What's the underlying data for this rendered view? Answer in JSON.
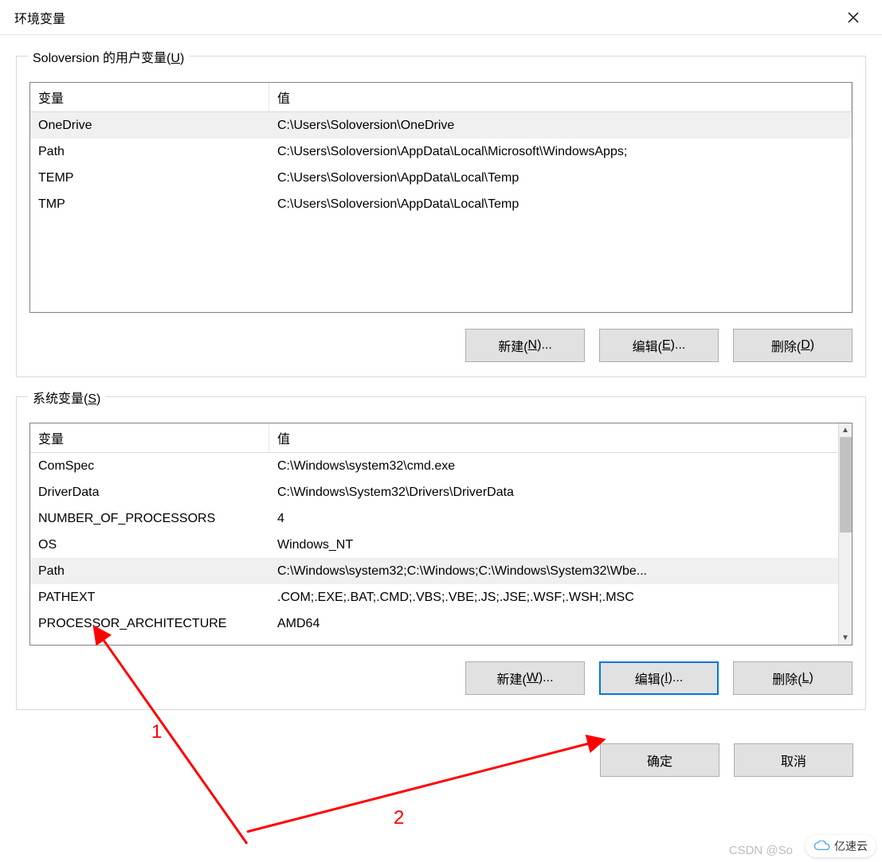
{
  "dialog": {
    "title": "环境变量"
  },
  "user_vars": {
    "label_prefix": "Soloversion 的用户变量(",
    "label_hotkey": "U",
    "label_suffix": ")",
    "columns": {
      "var": "变量",
      "val": "值"
    },
    "rows": [
      {
        "var": "OneDrive",
        "val": "C:\\Users\\Soloversion\\OneDrive",
        "selected": true
      },
      {
        "var": "Path",
        "val": "C:\\Users\\Soloversion\\AppData\\Local\\Microsoft\\WindowsApps;",
        "selected": false
      },
      {
        "var": "TEMP",
        "val": "C:\\Users\\Soloversion\\AppData\\Local\\Temp",
        "selected": false
      },
      {
        "var": "TMP",
        "val": "C:\\Users\\Soloversion\\AppData\\Local\\Temp",
        "selected": false
      }
    ],
    "buttons": {
      "new_prefix": "新建(",
      "new_hotkey": "N",
      "new_suffix": ")...",
      "edit_prefix": "编辑(",
      "edit_hotkey": "E",
      "edit_suffix": ")...",
      "delete_prefix": "删除(",
      "delete_hotkey": "D",
      "delete_suffix": ")"
    }
  },
  "sys_vars": {
    "label_prefix": "系统变量(",
    "label_hotkey": "S",
    "label_suffix": ")",
    "columns": {
      "var": "变量",
      "val": "值"
    },
    "rows": [
      {
        "var": "ComSpec",
        "val": "C:\\Windows\\system32\\cmd.exe",
        "selected": false
      },
      {
        "var": "DriverData",
        "val": "C:\\Windows\\System32\\Drivers\\DriverData",
        "selected": false
      },
      {
        "var": "NUMBER_OF_PROCESSORS",
        "val": "4",
        "selected": false
      },
      {
        "var": "OS",
        "val": "Windows_NT",
        "selected": false
      },
      {
        "var": "Path",
        "val": "C:\\Windows\\system32;C:\\Windows;C:\\Windows\\System32\\Wbe...",
        "selected": true
      },
      {
        "var": "PATHEXT",
        "val": ".COM;.EXE;.BAT;.CMD;.VBS;.VBE;.JS;.JSE;.WSF;.WSH;.MSC",
        "selected": false
      },
      {
        "var": "PROCESSOR_ARCHITECTURE",
        "val": "AMD64",
        "selected": false
      }
    ],
    "buttons": {
      "new_prefix": "新建(",
      "new_hotkey": "W",
      "new_suffix": ")...",
      "edit_prefix": "编辑(",
      "edit_hotkey": "I",
      "edit_suffix": ")...",
      "delete_prefix": "删除(",
      "delete_hotkey": "L",
      "delete_suffix": ")"
    }
  },
  "footer": {
    "ok": "确定",
    "cancel": "取消"
  },
  "annotations": {
    "label1": "1",
    "label2": "2"
  },
  "watermark": "CSDN @So",
  "corner_brand": "亿速云"
}
